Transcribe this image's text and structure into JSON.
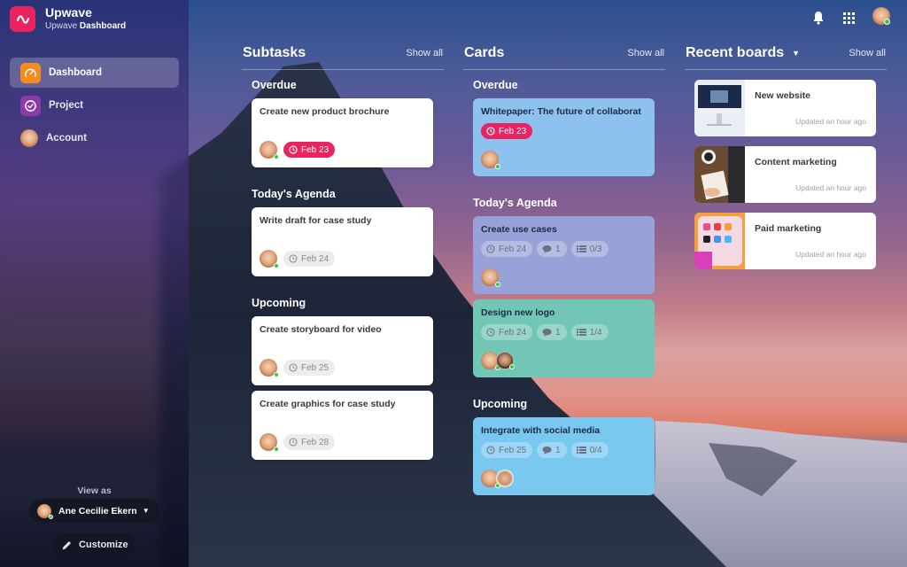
{
  "app": {
    "name": "Upwave",
    "subtitle_prefix": "Upwave",
    "subtitle_bold": "Dashboard"
  },
  "sidebar": {
    "items": [
      {
        "label": "Dashboard",
        "icon": "speedometer-icon",
        "active": true
      },
      {
        "label": "Project",
        "icon": "check-circle-icon",
        "active": false
      },
      {
        "label": "Account",
        "icon": "avatar",
        "active": false
      }
    ],
    "view_as_label": "View as",
    "view_as_user": "Ane Cecilie Ekern",
    "customize_label": "Customize"
  },
  "topbar": {
    "icons": [
      "bell-icon",
      "apps-grid-icon",
      "user-avatar"
    ]
  },
  "subtasks": {
    "title": "Subtasks",
    "show_all": "Show all",
    "sections": [
      {
        "title": "Overdue",
        "cards": [
          {
            "title": "Create new product brochure",
            "date": "Feb 23",
            "overdue": true
          }
        ]
      },
      {
        "title": "Today's Agenda",
        "cards": [
          {
            "title": "Write draft for case study",
            "date": "Feb 24",
            "overdue": false
          }
        ]
      },
      {
        "title": "Upcoming",
        "cards": [
          {
            "title": "Create storyboard for video",
            "date": "Feb 25",
            "overdue": false
          },
          {
            "title": "Create graphics for case study",
            "date": "Feb 28",
            "overdue": false
          }
        ]
      }
    ]
  },
  "cards": {
    "title": "Cards",
    "show_all": "Show all",
    "sections": [
      {
        "title": "Overdue",
        "cards": [
          {
            "title": "Whitepaper: The future of collaborat",
            "date": "Feb 23",
            "overdue": true,
            "color": "#8dc2ef"
          }
        ]
      },
      {
        "title": "Today's Agenda",
        "cards": [
          {
            "title": "Create use cases",
            "date": "Feb 24",
            "comments": "1",
            "checklist": "0/3",
            "color": "#98a2d8"
          },
          {
            "title": "Design new logo",
            "date": "Feb 24",
            "comments": "1",
            "checklist": "1/4",
            "color": "#72c6b6"
          }
        ]
      },
      {
        "title": "Upcoming",
        "cards": [
          {
            "title": "Integrate with social media",
            "date": "Feb 25",
            "comments": "1",
            "checklist": "0/4",
            "color": "#78c8f0"
          }
        ]
      }
    ]
  },
  "recent_boards": {
    "title": "Recent boards",
    "show_all": "Show all",
    "boards": [
      {
        "name": "New website",
        "updated": "Updated an hour ago"
      },
      {
        "name": "Content marketing",
        "updated": "Updated an hour ago"
      },
      {
        "name": "Paid marketing",
        "updated": "Updated an hour ago"
      }
    ]
  },
  "colors": {
    "brand": "#e8235f",
    "overdue": "#e8235f",
    "online": "#2ecc40"
  }
}
